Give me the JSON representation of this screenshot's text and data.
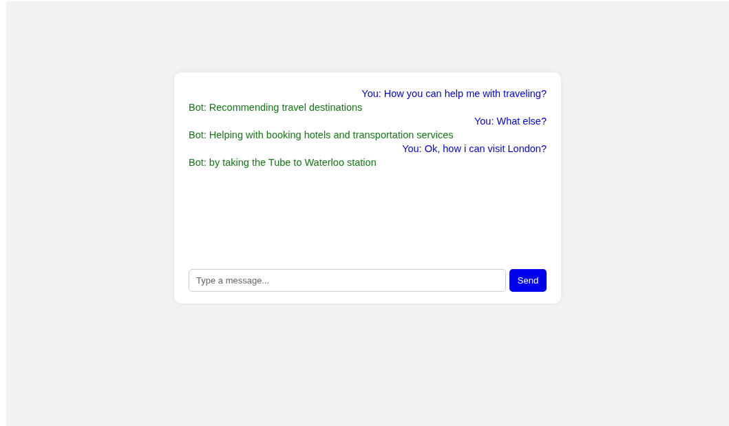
{
  "messages": [
    {
      "kind": "user",
      "text": "You: How you can help me with traveling?"
    },
    {
      "kind": "bot",
      "text": "Bot: Recommending travel destinations"
    },
    {
      "kind": "user",
      "text": "You: What else?"
    },
    {
      "kind": "bot",
      "text": "Bot: Helping with booking hotels and transportation services"
    },
    {
      "kind": "user",
      "text": "You: Ok, how i can visit London?"
    },
    {
      "kind": "bot",
      "text": "Bot: by taking the Tube to Waterloo station"
    }
  ],
  "input": {
    "placeholder": "Type a message..."
  },
  "send_button": {
    "label": "Send"
  }
}
